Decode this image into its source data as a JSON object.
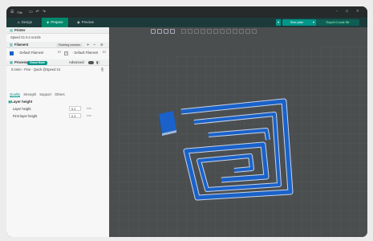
{
  "titlebar": {
    "app_menu": "File",
    "menu_icon": "hamburger-icon",
    "buttons": [
      "save-icon",
      "undo-icon",
      "redo-icon"
    ]
  },
  "tabs": [
    {
      "label": "Design",
      "icon": "home-icon",
      "active": false
    },
    {
      "label": "Prepare",
      "icon": "cube-icon",
      "active": true
    },
    {
      "label": "Preview",
      "icon": "preview-icon",
      "active": false
    }
  ],
  "actions": {
    "slice": "Slice plate",
    "export": "Export G-code file"
  },
  "sidebar": {
    "printer_header": "Printer",
    "printer_value": "Speed X1 0.4 nozzle",
    "filament_header": "Filament",
    "filament_pill": "Flushing volumes",
    "filament_1": "Default Filament",
    "filament_2_index": "2",
    "filament_2": "Default Filament",
    "process_header": "Process",
    "process_pill": "Global Mode",
    "advanced_label": "Advanced",
    "process_value": "0.2mm - Fine - Quick @Speed X1",
    "subtabs": [
      "Quality",
      "Strength",
      "Support",
      "Others"
    ],
    "section_title": "Layer height",
    "params": [
      {
        "label": "Layer height",
        "value": "0.2",
        "unit": "mm"
      },
      {
        "label": "First layer height",
        "value": "0.3",
        "unit": "mm"
      }
    ]
  },
  "colors": {
    "accent": "#009688",
    "filament_blue": "#1a62c9"
  }
}
